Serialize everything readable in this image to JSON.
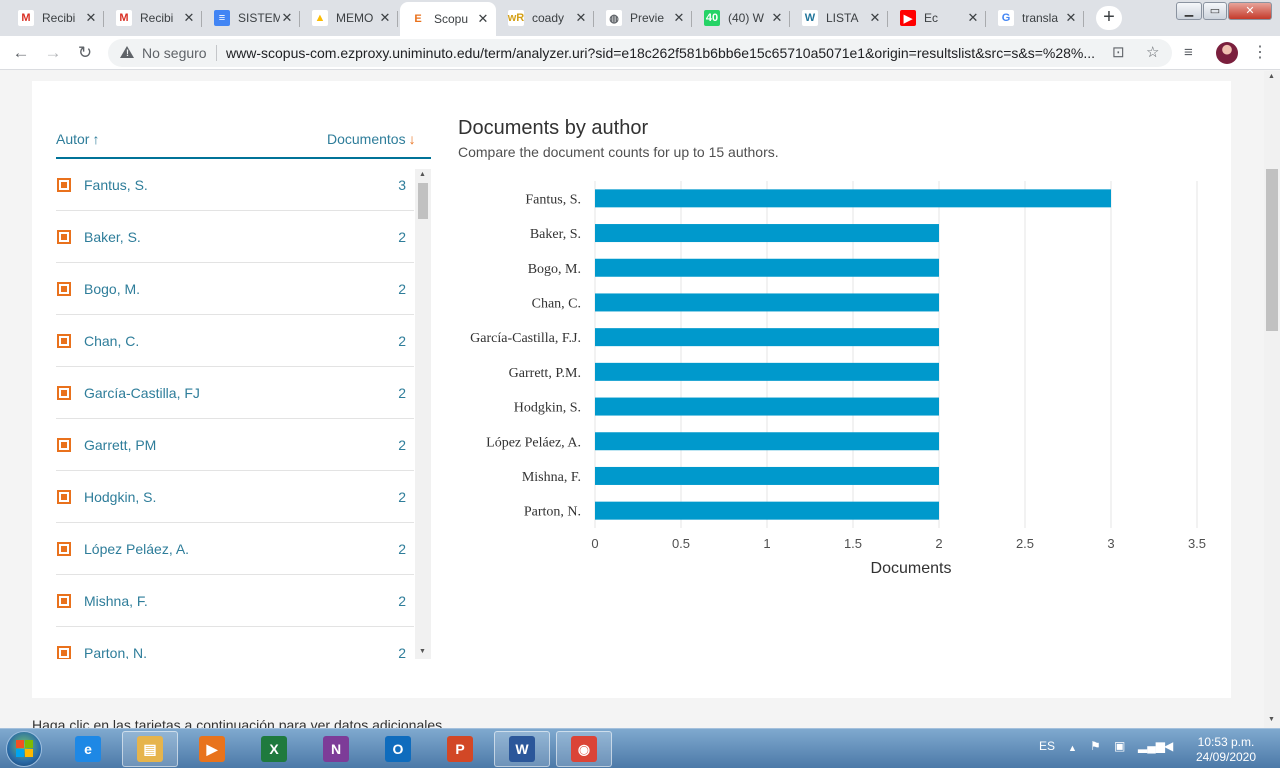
{
  "browser": {
    "tabs": [
      {
        "title": "Recibi",
        "icon": "gmail-icon",
        "active": false
      },
      {
        "title": "Recibi",
        "icon": "gmail-icon",
        "active": false
      },
      {
        "title": "SISTEM",
        "icon": "google-docs-icon",
        "active": false
      },
      {
        "title": "MEMO",
        "icon": "google-drive-icon",
        "active": false
      },
      {
        "title": "Scopu",
        "icon": "elsevier-icon",
        "active": true
      },
      {
        "title": "coady",
        "icon": "wordreference-icon",
        "active": false
      },
      {
        "title": "Previe",
        "icon": "globe-icon",
        "active": false
      },
      {
        "title": "(40) W",
        "icon": "whatsapp-icon",
        "active": false
      },
      {
        "title": "LISTA",
        "icon": "wordpress-icon",
        "active": false
      },
      {
        "title": "Ec",
        "icon": "youtube-icon",
        "active": false
      },
      {
        "title": "transla",
        "icon": "google-icon",
        "active": false
      }
    ],
    "security_label": "No seguro",
    "url": "www-scopus-com.ezproxy.uniminuto.edu/term/analyzer.uri?sid=e18c262f581b6bb6e15c65710a5071e1&origin=resultslist&src=s&s=%28%..."
  },
  "authors": {
    "header_author": "Autor",
    "header_docs": "Documentos",
    "rows": [
      {
        "name": "Fantus, S.",
        "count": "3"
      },
      {
        "name": "Baker, S.",
        "count": "2"
      },
      {
        "name": "Bogo, M.",
        "count": "2"
      },
      {
        "name": "Chan, C.",
        "count": "2"
      },
      {
        "name": "García-Castilla, FJ",
        "count": "2"
      },
      {
        "name": "Garrett, PM",
        "count": "2"
      },
      {
        "name": "Hodgkin, S.",
        "count": "2"
      },
      {
        "name": "López Peláez, A.",
        "count": "2"
      },
      {
        "name": "Mishna, F.",
        "count": "2"
      },
      {
        "name": "Parton, N.",
        "count": "2"
      }
    ]
  },
  "chart_title": "Documents by author",
  "chart_subtitle": "Compare the document counts for up to 15 authors.",
  "chart_data": {
    "type": "bar",
    "orientation": "horizontal",
    "categories": [
      "Fantus, S.",
      "Baker, S.",
      "Bogo, M.",
      "Chan, C.",
      "García-Castilla, F.J.",
      "Garrett, P.M.",
      "Hodgkin, S.",
      "López Peláez, A.",
      "Mishna, F.",
      "Parton, N."
    ],
    "values": [
      3,
      2,
      2,
      2,
      2,
      2,
      2,
      2,
      2,
      2
    ],
    "xlabel": "Documents",
    "ylabel": "",
    "xlim": [
      0,
      3.5
    ],
    "xticks": [
      "0",
      "0.5",
      "1",
      "1.5",
      "2",
      "2.5",
      "3",
      "3.5"
    ],
    "grid": true,
    "bar_color": "#0099cc"
  },
  "below_text": "Haga clic en las tarjetas a continuación para ver datos adicionales",
  "taskbar": {
    "apps": [
      "internet-explorer-icon",
      "file-explorer-icon",
      "media-player-icon",
      "excel-icon",
      "onenote-icon",
      "outlook-icon",
      "powerpoint-icon",
      "word-icon",
      "chrome-icon"
    ],
    "language": "ES",
    "time": "10:53 p.m.",
    "date": "24/09/2020"
  }
}
